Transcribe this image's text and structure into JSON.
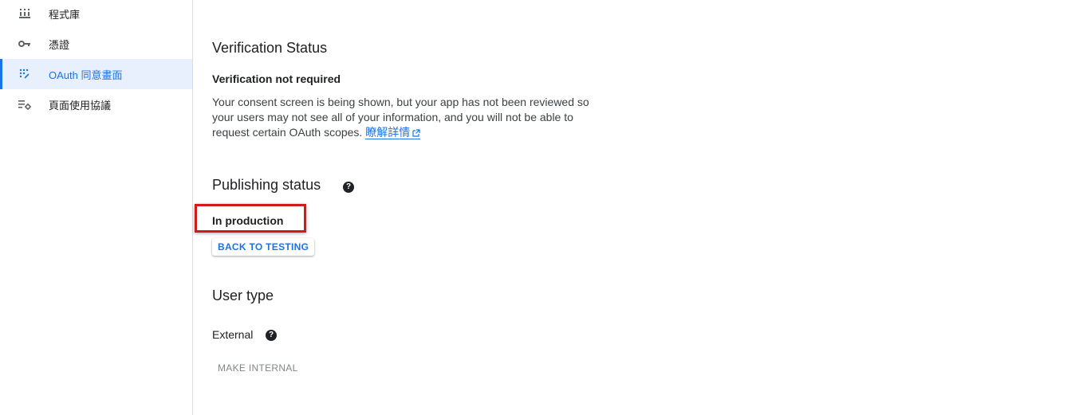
{
  "sidebar": {
    "items": [
      {
        "label": "程式庫",
        "icon": "library-icon"
      },
      {
        "label": "憑證",
        "icon": "key-icon"
      },
      {
        "label": "OAuth 同意畫面",
        "icon": "consent-screen-icon",
        "active": true
      },
      {
        "label": "頁面使用協議",
        "icon": "page-usage-agreement-icon"
      }
    ]
  },
  "verification": {
    "title": "Verification Status",
    "subtitle": "Verification not required",
    "description": "Your consent screen is being shown, but your app has not been reviewed so your users may not see all of your information, and you will not be able to request certain OAuth scopes.",
    "link_text": "瞭解詳情"
  },
  "publishing": {
    "title": "Publishing status",
    "status": "In production",
    "button_label": "BACK TO TESTING"
  },
  "user_type": {
    "title": "User type",
    "value": "External",
    "button_label": "MAKE INTERNAL"
  },
  "colors": {
    "accent": "#1a73e8",
    "highlight": "#d11a1a",
    "active_bg": "#e8f0fe"
  }
}
